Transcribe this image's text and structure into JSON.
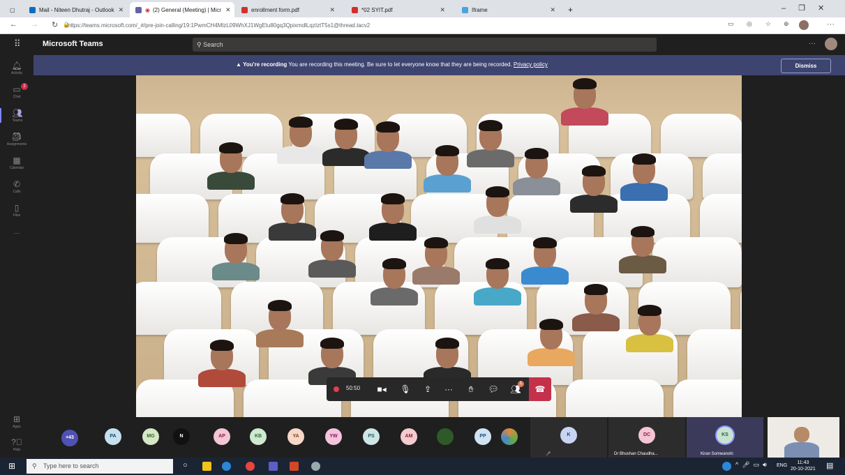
{
  "browser": {
    "tabs": [
      {
        "label": "Mail - Niteen Dhutraj - Outlook",
        "color": "#0f6cbd"
      },
      {
        "label": "(2) General (Meeting) | Micr",
        "color": "#6264a7"
      },
      {
        "label": "enrollment form.pdf",
        "color": "#d32f2f"
      },
      {
        "label": "*02 SYIT.pdf",
        "color": "#d32f2f"
      },
      {
        "label": "Iframe",
        "color": "#4aa3df"
      }
    ],
    "new_tab": "+",
    "url": "https://teams.microsoft.com/_#/pre-join-calling/19:1PwmCH4MlzL09WhXJ1WgEIu80gq3QpixmdlLqzIztT5s1@thread.tacv2"
  },
  "teams": {
    "app_name": "Microsoft Teams",
    "search_placeholder": "Search",
    "more": "···",
    "rail": [
      {
        "label": "Activity",
        "icon": "bell-icon"
      },
      {
        "label": "Chat",
        "icon": "chat-icon",
        "badge": "2"
      },
      {
        "label": "Teams",
        "icon": "teams-icon"
      },
      {
        "label": "Assignments",
        "icon": "assignments-icon"
      },
      {
        "label": "Calendar",
        "icon": "calendar-icon"
      },
      {
        "label": "Calls",
        "icon": "phone-icon"
      },
      {
        "label": "Files",
        "icon": "file-icon"
      },
      {
        "label": "···",
        "icon": "more-icon"
      },
      {
        "label": "Apps",
        "icon": "apps-icon"
      },
      {
        "label": "Help",
        "icon": "help-icon"
      }
    ]
  },
  "banner": {
    "title": "You're recording",
    "message": "You are recording this meeting. Be sure to let everyone know that they are being recorded.",
    "link": "Privacy policy",
    "dismiss": "Dismiss"
  },
  "controls": {
    "timer": "50:50",
    "participants_badge": "1"
  },
  "participants": {
    "overflow": "+43",
    "avatars": [
      {
        "initials": "PA",
        "bg": "#c7e0ef",
        "fg": "#1b4a66"
      },
      {
        "initials": "MG",
        "bg": "#d5e8c6",
        "fg": "#3c5f25"
      },
      {
        "initials": "N",
        "bg": "#111111",
        "fg": "#ffffff"
      },
      {
        "initials": "AP",
        "bg": "#f3c5d5",
        "fg": "#8b1e44"
      },
      {
        "initials": "KB",
        "bg": "#cfe9d0",
        "fg": "#2e6a32"
      },
      {
        "initials": "YA",
        "bg": "#f6d8c9",
        "fg": "#8a3c1c"
      },
      {
        "initials": "YW",
        "bg": "#f4c3dd",
        "fg": "#8b1652"
      },
      {
        "initials": "PS",
        "bg": "#cfe6e6",
        "fg": "#245c5c"
      },
      {
        "initials": "AM",
        "bg": "#f5cbd0",
        "fg": "#8b2030"
      },
      {
        "initials": "",
        "bg": "#2e5a2a",
        "fg": "#ffffff"
      },
      {
        "initials": "PP",
        "bg": "#cfe3f3",
        "fg": "#1f4f78"
      }
    ],
    "tiles": [
      {
        "initials": "K",
        "name": ""
      },
      {
        "initials": "DC",
        "name": "Dr Bhushan Chaudha..."
      },
      {
        "initials": "KS",
        "name": "Kiran Somwanshi"
      }
    ]
  },
  "taskbar": {
    "search_placeholder": "Type here to search",
    "lang": "ENG",
    "time": "11:43",
    "date": "20-10-2021",
    "notif_badge": "2"
  }
}
